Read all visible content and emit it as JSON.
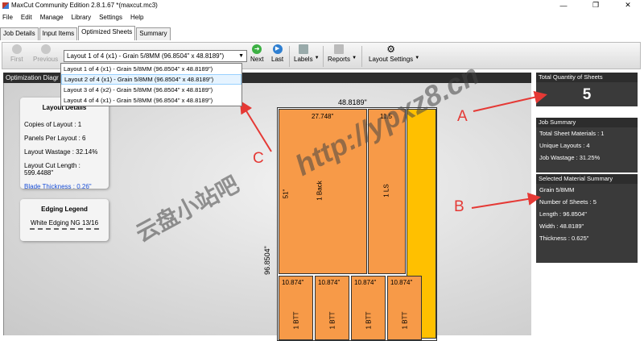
{
  "window": {
    "title": "MaxCut Community Edition 2.8.1.67 *(maxcut.mc3)"
  },
  "menu": [
    "File",
    "Edit",
    "Manage",
    "Library",
    "Settings",
    "Help"
  ],
  "tabs": [
    "Job Details",
    "Input Items",
    "Optimized Sheets",
    "Summary"
  ],
  "toolbar": {
    "first": "First",
    "previous": "Previous",
    "next": "Next",
    "last": "Last",
    "labels": "Labels",
    "reports": "Reports",
    "layout_settings": "Layout Settings",
    "selected_layout": "Layout 1 of 4 (x1) - Grain 5/8MM (96.8504\" x 48.8189\")"
  },
  "dropdown_options": [
    "Layout 1 of 4 (x1) - Grain 5/8MM (96.8504\" x 48.8189\")",
    "Layout 2 of 4 (x1) - Grain 5/8MM (96.8504\" x 48.8189\")",
    "Layout 3 of 4 (x2) - Grain 5/8MM (96.8504\" x 48.8189\")",
    "Layout 4 of 4 (x1) - Grain 5/8MM (96.8504\" x 48.8189\")"
  ],
  "panel_title": "Optimization Diagr",
  "layout_details": {
    "title": "Layout Details",
    "rows": [
      "Copies of Layout :  1",
      "Panels Per Layout :  6",
      "Layout Wastage :  32.14%",
      "Layout Cut Length :  599.4488\"",
      "Blade Thickness :  0.26\""
    ]
  },
  "edging_legend": {
    "title": "Edging Legend",
    "item": "White Edging NG 13/16"
  },
  "sheet": {
    "width_label": "48.8189\"",
    "height_label": "96.8504\"",
    "parts": [
      {
        "dim": "27.748\"",
        "side": "51\"",
        "name": "1 Back"
      },
      {
        "dim": "11.5",
        "name": "1 LS"
      },
      {
        "dim": "10.874\"",
        "name": "1 BTT"
      },
      {
        "dim": "10.874\"",
        "name": "1 BTT"
      },
      {
        "dim": "10.874\"",
        "name": "1 BTT"
      },
      {
        "dim": "10.874\"",
        "name": "1 BTT"
      }
    ]
  },
  "total_sheets": {
    "title": "Total Quantity of Sheets",
    "value": "5"
  },
  "job_summary": {
    "title": "Job Summary",
    "rows": [
      "Total Sheet Materials :  1",
      "Unique Layouts :  4",
      "Job Wastage :  31.25%"
    ]
  },
  "material_summary": {
    "title": "Selected Material Summary",
    "rows": [
      "Grain 5/8MM",
      "Number of Sheets :  5",
      "Length :  96.8504\"",
      "Width :  48.8189\"",
      "Thickness :  0.625\""
    ]
  },
  "annotations": {
    "a": "A",
    "b": "B",
    "c": "C"
  },
  "watermark": {
    "cn": "云盘小站吧",
    "url": "http://ypxz8.cn"
  },
  "colors": {
    "part": "#f79a48",
    "offcut": "#ffc000",
    "panel_dark": "#2d2d2d",
    "arrow": "#e53935"
  }
}
